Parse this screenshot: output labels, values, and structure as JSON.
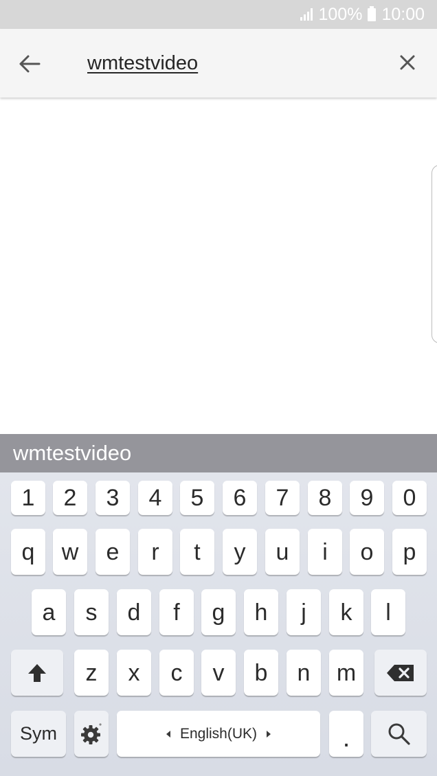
{
  "status_bar": {
    "battery_percent": "100%",
    "time": "10:00",
    "icons": [
      "signal-icon",
      "battery-icon"
    ]
  },
  "search_bar": {
    "back_icon": "back-arrow-icon",
    "query": "wmtestvideo",
    "clear_icon": "close-icon"
  },
  "keyboard": {
    "suggestion": "wmtestvideo",
    "row_numbers": [
      "1",
      "2",
      "3",
      "4",
      "5",
      "6",
      "7",
      "8",
      "9",
      "0"
    ],
    "row_qwerty": [
      "q",
      "w",
      "e",
      "r",
      "t",
      "y",
      "u",
      "i",
      "o",
      "p"
    ],
    "row_asdf": [
      "a",
      "s",
      "d",
      "f",
      "g",
      "h",
      "j",
      "k",
      "l"
    ],
    "row_zxcv": [
      "z",
      "x",
      "c",
      "v",
      "b",
      "n",
      "m"
    ],
    "sym_label": "Sym",
    "language_label": "English(UK)",
    "period_label": ".",
    "icons": [
      "shift-icon",
      "backspace-icon",
      "settings-gear-icon",
      "search-icon"
    ]
  },
  "colors": {
    "status_bar_bg": "#d7d7d7",
    "search_bar_bg": "#f5f5f5",
    "suggestion_bg": "#95959b",
    "keyboard_bg": "#dde0e8"
  }
}
